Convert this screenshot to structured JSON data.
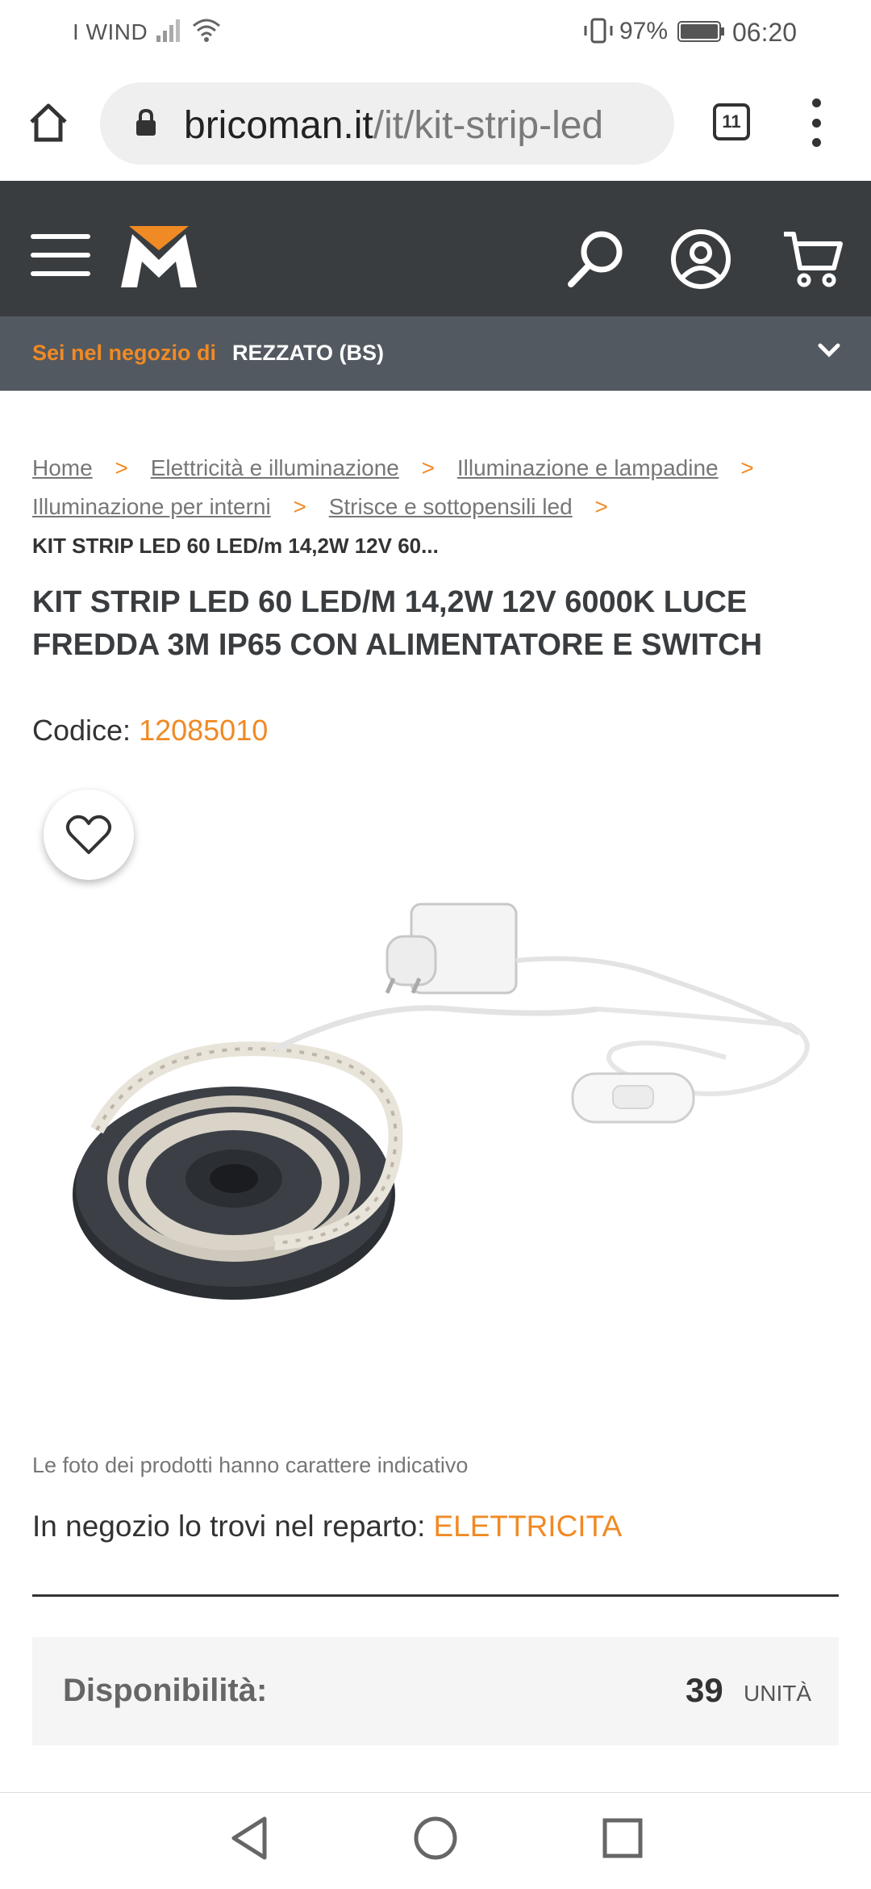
{
  "status_bar": {
    "carrier": "I WIND",
    "battery_percent": "97%",
    "time": "06:20"
  },
  "browser": {
    "url_host": "bricoman.it",
    "url_path": "/it/kit-strip-led",
    "tab_count": "11"
  },
  "store_bar": {
    "label": "Sei nel negozio di",
    "store_name": "REZZATO (BS)"
  },
  "breadcrumb": {
    "items": [
      "Home",
      "Elettricità e illuminazione",
      "Illuminazione e lampadine",
      "Illuminazione per interni",
      "Strisce e sottopensili led"
    ],
    "current": "KIT STRIP LED 60 LED/m 14,2W 12V 60..."
  },
  "product": {
    "title": "KIT STRIP LED 60 LED/M 14,2W 12V 6000K LUCE FREDDA 3M IP65 CON ALIMENTATORE E SWITCH",
    "code_label": "Codice:",
    "code_value": "12085010",
    "photo_note": "Le foto dei prodotti hanno carattere indicativo",
    "reparto_label": "In negozio lo trovi nel reparto:",
    "reparto_value": "ELETTRICITA"
  },
  "availability": {
    "label": "Disponibilità:",
    "quantity": "39",
    "unit": "UNITÀ"
  },
  "colors": {
    "accent": "#f08a24",
    "header_bg": "#3a3d40",
    "store_bar_bg": "#535960"
  },
  "icons": {
    "home": "home-icon",
    "lock": "lock-icon",
    "menu": "more-vert-icon",
    "hamburger": "hamburger-icon",
    "search": "search-icon",
    "account": "account-icon",
    "cart": "cart-icon",
    "favorite": "heart-icon",
    "nav_back": "back-triangle-icon",
    "nav_home": "home-circle-icon",
    "nav_recent": "recent-square-icon"
  }
}
